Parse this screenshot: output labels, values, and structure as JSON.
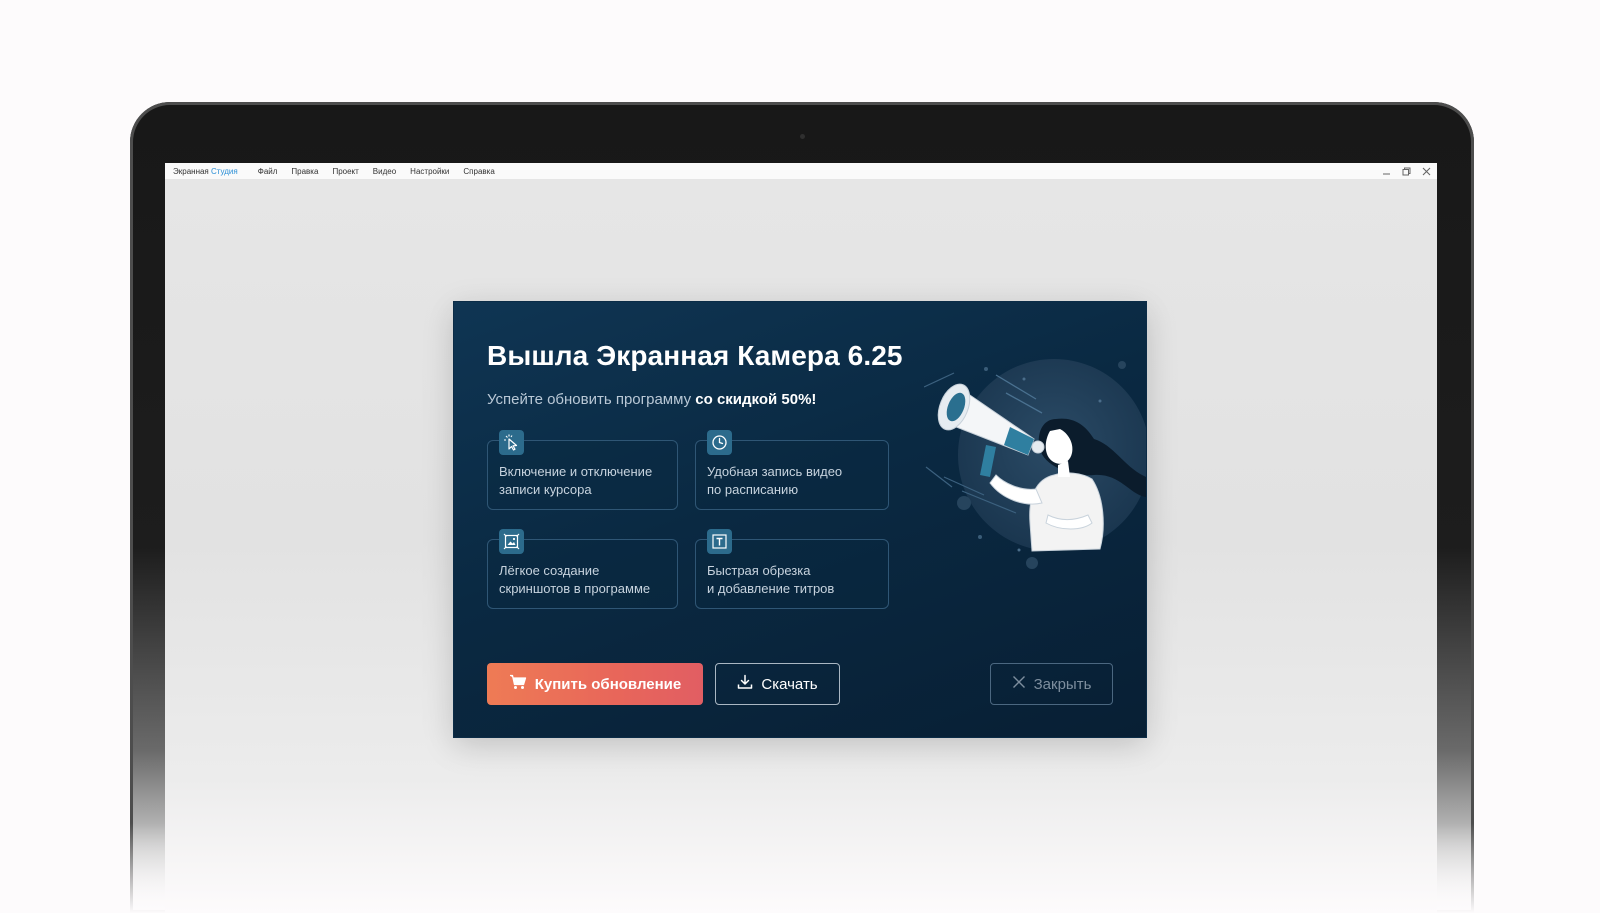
{
  "menubar": {
    "app_name": "Экранная",
    "app_name_accent": "Студия",
    "items": [
      "Файл",
      "Правка",
      "Проект",
      "Видео",
      "Настройки",
      "Справка"
    ]
  },
  "dialog": {
    "title": "Вышла Экранная Камера 6.25",
    "subtitle_prefix": "Успейте обновить программу ",
    "subtitle_bold": "со скидкой 50%!",
    "features": [
      {
        "icon": "cursor-icon",
        "text": "Включение и отключение\nзаписи курсора"
      },
      {
        "icon": "clock-icon",
        "text": "Удобная запись видео\nпо расписанию"
      },
      {
        "icon": "screenshot-icon",
        "text": "Лёгкое создание\nскриншотов в программе"
      },
      {
        "icon": "text-icon",
        "text": "Быстрая обрезка\nи добавление титров"
      }
    ],
    "buttons": {
      "buy": "Купить обновление",
      "download": "Скачать",
      "close": "Закрыть"
    }
  },
  "colors": {
    "dialog_bg": "#0a2942",
    "accent_orange": "#ec7352",
    "menubar_accent": "#2b8fd6",
    "icon_bg": "#2c6b8c"
  }
}
